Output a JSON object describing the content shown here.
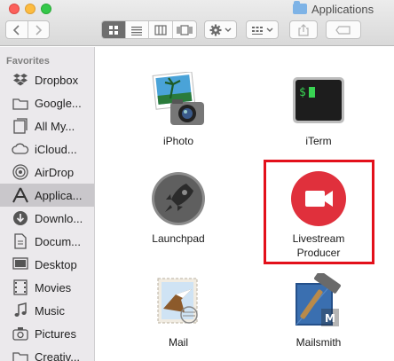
{
  "window": {
    "title": "Applications",
    "title_icon": "folder-icon"
  },
  "toolbar": {
    "back_icon": "chevron-left-icon",
    "forward_icon": "chevron-right-icon",
    "view_modes": [
      "icon-view",
      "list-view",
      "column-view",
      "coverflow-view"
    ],
    "active_view": "icon-view",
    "action_icon": "gear-icon",
    "arrange_icon": "grid-arrange-icon",
    "share_icon": "share-icon",
    "tags_icon": "tag-icon"
  },
  "sidebar": {
    "heading": "Favorites",
    "items": [
      {
        "label": "Dropbox",
        "icon": "dropbox-icon"
      },
      {
        "label": "Google...",
        "icon": "folder-icon"
      },
      {
        "label": "All My...",
        "icon": "files-icon"
      },
      {
        "label": "iCloud...",
        "icon": "cloud-icon"
      },
      {
        "label": "AirDrop",
        "icon": "airdrop-icon"
      },
      {
        "label": "Applica...",
        "icon": "applications-icon",
        "selected": true
      },
      {
        "label": "Downlo...",
        "icon": "download-icon"
      },
      {
        "label": "Docum...",
        "icon": "document-icon"
      },
      {
        "label": "Desktop",
        "icon": "desktop-icon"
      },
      {
        "label": "Movies",
        "icon": "film-icon"
      },
      {
        "label": "Music",
        "icon": "music-icon"
      },
      {
        "label": "Pictures",
        "icon": "camera-icon"
      },
      {
        "label": "Creativ...",
        "icon": "folder-icon"
      }
    ]
  },
  "apps": [
    {
      "label": "iPhoto",
      "icon": "iphoto-icon"
    },
    {
      "label": "iTerm",
      "icon": "iterm-icon"
    },
    {
      "label": "Launchpad",
      "icon": "launchpad-icon"
    },
    {
      "label": "Livestream Producer",
      "label_line1": "Livestream",
      "label_line2": "Producer",
      "icon": "livestream-icon",
      "highlighted": true
    },
    {
      "label": "Mail",
      "icon": "mail-icon"
    },
    {
      "label": "Mailsmith",
      "icon": "mailsmith-icon"
    }
  ],
  "colors": {
    "highlight": "#e3101b",
    "livestream_red": "#e0303c",
    "sidebar_bg": "#ebe9ec",
    "selected_bg": "#c9c7cb"
  }
}
